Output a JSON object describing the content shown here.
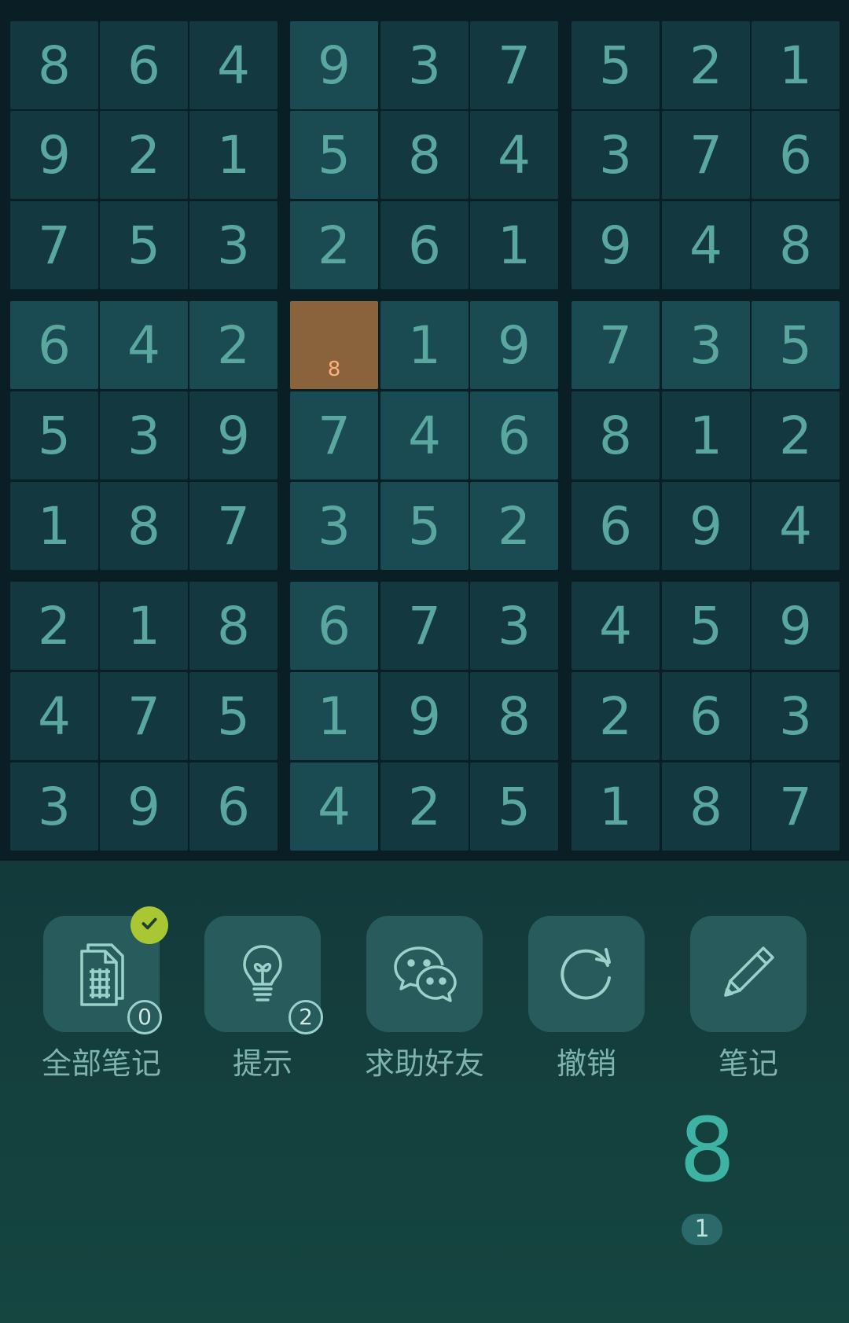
{
  "board": {
    "rows": [
      [
        "8",
        "6",
        "4",
        "9",
        "3",
        "7",
        "5",
        "2",
        "1"
      ],
      [
        "9",
        "2",
        "1",
        "5",
        "8",
        "4",
        "3",
        "7",
        "6"
      ],
      [
        "7",
        "5",
        "3",
        "2",
        "6",
        "1",
        "9",
        "4",
        "8"
      ],
      [
        "6",
        "4",
        "2",
        "",
        "1",
        "9",
        "7",
        "3",
        "5"
      ],
      [
        "5",
        "3",
        "9",
        "7",
        "4",
        "6",
        "8",
        "1",
        "2"
      ],
      [
        "1",
        "8",
        "7",
        "3",
        "5",
        "2",
        "6",
        "9",
        "4"
      ],
      [
        "2",
        "1",
        "8",
        "6",
        "7",
        "3",
        "4",
        "5",
        "9"
      ],
      [
        "4",
        "7",
        "5",
        "1",
        "9",
        "8",
        "2",
        "6",
        "3"
      ],
      [
        "3",
        "9",
        "6",
        "4",
        "2",
        "5",
        "1",
        "8",
        "7"
      ]
    ],
    "selected": {
      "row": 3,
      "col": 3,
      "note": "8"
    }
  },
  "tools": [
    {
      "label": "全部笔记",
      "icon": "notes-sheet-icon",
      "count": "0",
      "checked": true
    },
    {
      "label": "提示",
      "icon": "lightbulb-icon",
      "count": "2"
    },
    {
      "label": "求助好友",
      "icon": "wechat-icon"
    },
    {
      "label": "撤销",
      "icon": "undo-icon"
    },
    {
      "label": "笔记",
      "icon": "pencil-icon"
    }
  ],
  "numpad": [
    {
      "number": "8",
      "remaining": "1"
    }
  ],
  "colors": {
    "digit": "#5aa7a0",
    "cell_dark": "#133840",
    "cell_light": "#1a4a52",
    "selected": "#88633b",
    "note": "#ffb07a",
    "pad_number": "#3fb3a3",
    "check_badge": "#a9c733"
  }
}
